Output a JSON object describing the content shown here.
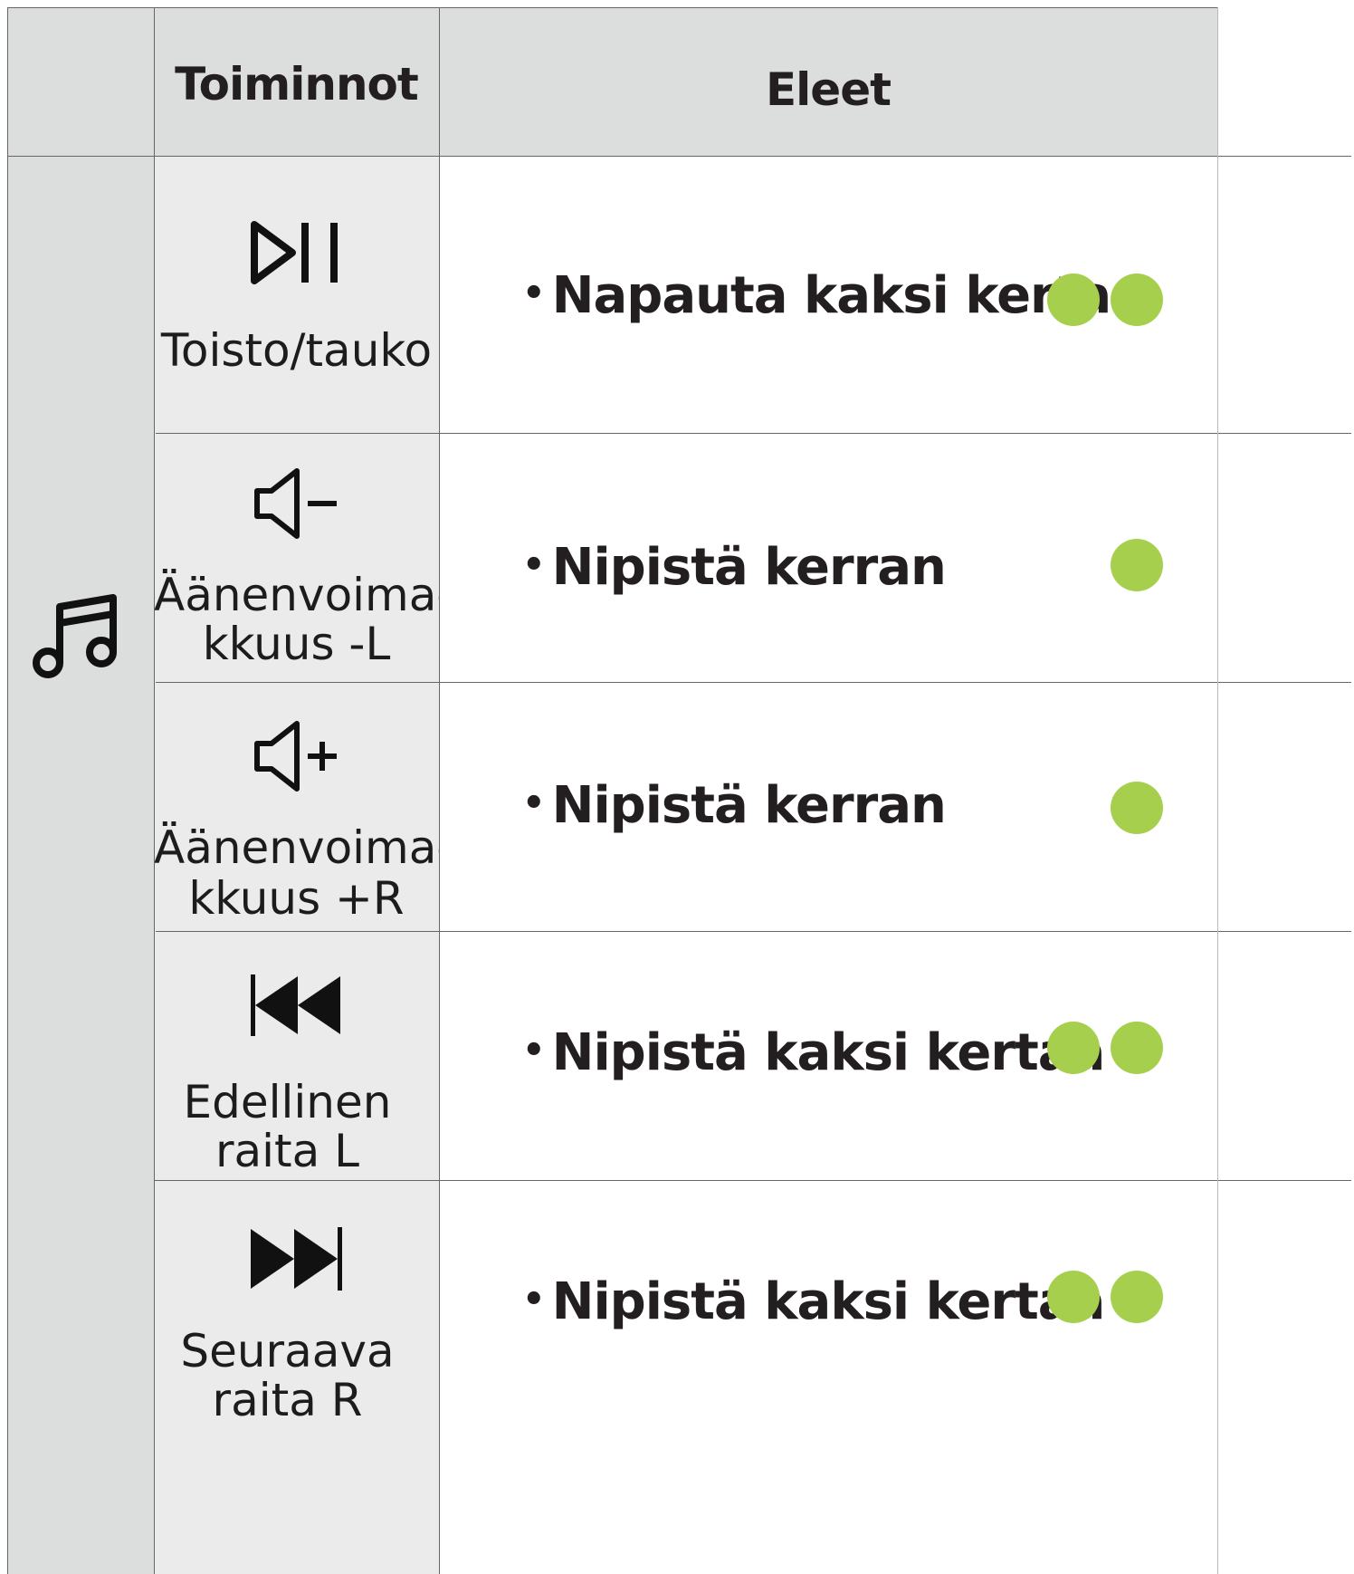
{
  "header": {
    "functions_label": "Toiminnot",
    "gestures_label": "Eleet"
  },
  "category_icon": "music-note-icon",
  "accent_color": "#a6cf4d",
  "rows": [
    {
      "icon": "play-pause-icon",
      "label_line1": "Toisto/tauko",
      "label_line2": "",
      "gesture": "Napauta kaksi kertaa",
      "dot_count": 2
    },
    {
      "icon": "volume-down-icon",
      "label_line1": "Äänenvoima-",
      "label_line2": "kkuus -L",
      "gesture": "Nipistä kerran",
      "dot_count": 1
    },
    {
      "icon": "volume-up-icon",
      "label_line1": "Äänenvoima-",
      "label_line2": "kkuus +R",
      "gesture": "Nipistä kerran",
      "dot_count": 1
    },
    {
      "icon": "previous-track-icon",
      "label_line1": "Edellinen",
      "label_line2": "raita L",
      "gesture": "Nipistä kaksi kertaa",
      "dot_count": 2
    },
    {
      "icon": "next-track-icon",
      "label_line1": "Seuraava",
      "label_line2": "raita R",
      "gesture": "Nipistä kaksi kertaa",
      "dot_count": 2
    }
  ]
}
